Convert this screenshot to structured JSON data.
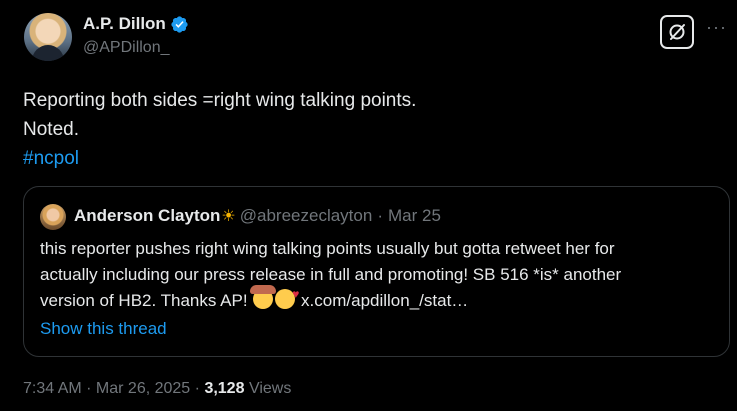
{
  "tweet": {
    "author_name": "A.P. Dillon",
    "handle": "@APDillon_",
    "text_lines": [
      "Reporting both sides =right wing talking points.",
      "Noted."
    ],
    "hashtag": "#ncpol",
    "timestamp": "7:34 AM · Mar 26, 2025 ·",
    "views_count": "3,128",
    "views_label": "Views"
  },
  "quote": {
    "author_name": "Anderson Clayton",
    "name_emoji": "☀",
    "handle": "@abreezeclayton",
    "separator": "·",
    "date": "Mar 25",
    "body_lines": [
      "this reporter pushes right wing talking points usually but gotta retweet her for",
      "actually including our press release in full and promoting! SB 516 *is* another",
      "version of HB2. Thanks AP!"
    ],
    "link_text": "x.com/apdillon_/stat…",
    "show_thread": "Show this thread"
  },
  "icons": {
    "verified": "verified-badge-icon",
    "grok": "grok-icon",
    "more": "more-options-icon"
  },
  "colors": {
    "background": "#000000",
    "accent": "#1d9bf0",
    "text": "#e7e9ea",
    "muted": "#71767b"
  }
}
